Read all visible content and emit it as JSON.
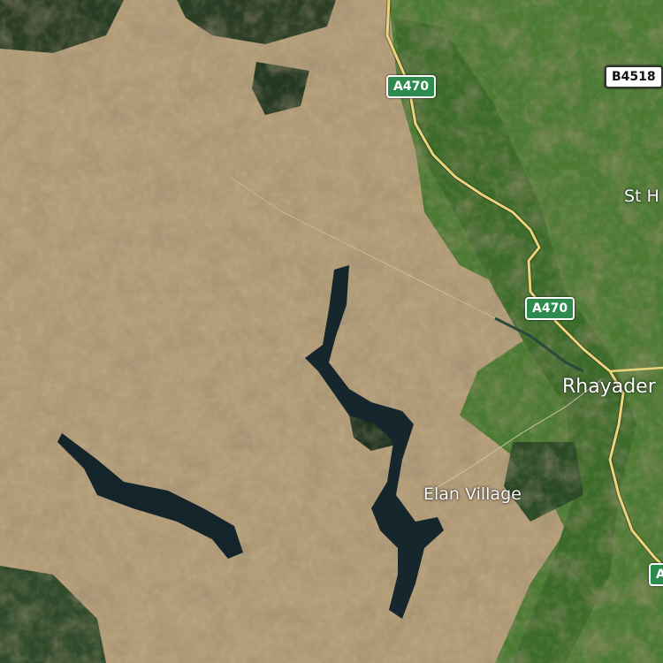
{
  "map": {
    "view": "satellite",
    "colors": {
      "upland": "#b7a07c",
      "upland_dark": "#8c7a58",
      "valley_green": "#3f6b2e",
      "farmland_green": "#4f7d35",
      "forest": "#23371f",
      "water": "#15262c",
      "road_major": "#e8d27a",
      "shield_primary": "#2e8b4e"
    },
    "roads": [
      {
        "name": "A470",
        "class": "primary"
      }
    ],
    "shields": [
      {
        "id": "a470-north",
        "label": "A470",
        "class": "primary"
      },
      {
        "id": "b4518",
        "label": "B4518",
        "class": "b-road"
      },
      {
        "id": "a470-middle",
        "label": "A470",
        "class": "primary"
      },
      {
        "id": "a470-south",
        "label": "A",
        "class": "primary"
      }
    ],
    "places": [
      {
        "id": "rhayader",
        "label": "Rhayader",
        "kind": "town"
      },
      {
        "id": "elan-village",
        "label": "Elan Village",
        "kind": "village"
      },
      {
        "id": "st-h",
        "label": "St H",
        "kind": "village"
      }
    ]
  }
}
